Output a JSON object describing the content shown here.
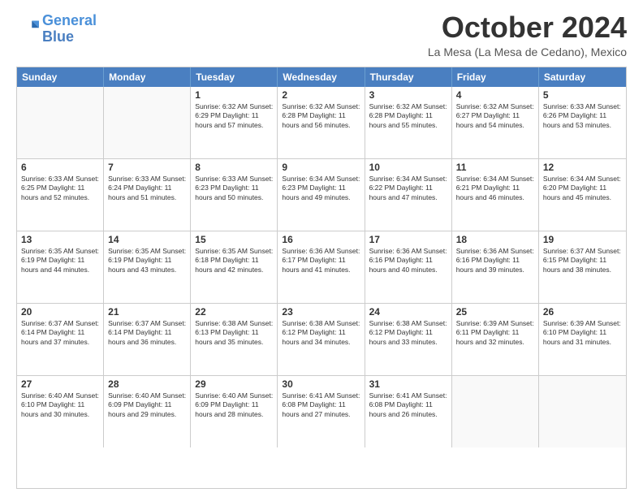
{
  "logo": {
    "line1": "General",
    "line2": "Blue"
  },
  "title": "October 2024",
  "location": "La Mesa (La Mesa de Cedano), Mexico",
  "header_days": [
    "Sunday",
    "Monday",
    "Tuesday",
    "Wednesday",
    "Thursday",
    "Friday",
    "Saturday"
  ],
  "weeks": [
    [
      {
        "day": "",
        "detail": ""
      },
      {
        "day": "",
        "detail": ""
      },
      {
        "day": "1",
        "detail": "Sunrise: 6:32 AM\nSunset: 6:29 PM\nDaylight: 11 hours and 57 minutes."
      },
      {
        "day": "2",
        "detail": "Sunrise: 6:32 AM\nSunset: 6:28 PM\nDaylight: 11 hours and 56 minutes."
      },
      {
        "day": "3",
        "detail": "Sunrise: 6:32 AM\nSunset: 6:28 PM\nDaylight: 11 hours and 55 minutes."
      },
      {
        "day": "4",
        "detail": "Sunrise: 6:32 AM\nSunset: 6:27 PM\nDaylight: 11 hours and 54 minutes."
      },
      {
        "day": "5",
        "detail": "Sunrise: 6:33 AM\nSunset: 6:26 PM\nDaylight: 11 hours and 53 minutes."
      }
    ],
    [
      {
        "day": "6",
        "detail": "Sunrise: 6:33 AM\nSunset: 6:25 PM\nDaylight: 11 hours and 52 minutes."
      },
      {
        "day": "7",
        "detail": "Sunrise: 6:33 AM\nSunset: 6:24 PM\nDaylight: 11 hours and 51 minutes."
      },
      {
        "day": "8",
        "detail": "Sunrise: 6:33 AM\nSunset: 6:23 PM\nDaylight: 11 hours and 50 minutes."
      },
      {
        "day": "9",
        "detail": "Sunrise: 6:34 AM\nSunset: 6:23 PM\nDaylight: 11 hours and 49 minutes."
      },
      {
        "day": "10",
        "detail": "Sunrise: 6:34 AM\nSunset: 6:22 PM\nDaylight: 11 hours and 47 minutes."
      },
      {
        "day": "11",
        "detail": "Sunrise: 6:34 AM\nSunset: 6:21 PM\nDaylight: 11 hours and 46 minutes."
      },
      {
        "day": "12",
        "detail": "Sunrise: 6:34 AM\nSunset: 6:20 PM\nDaylight: 11 hours and 45 minutes."
      }
    ],
    [
      {
        "day": "13",
        "detail": "Sunrise: 6:35 AM\nSunset: 6:19 PM\nDaylight: 11 hours and 44 minutes."
      },
      {
        "day": "14",
        "detail": "Sunrise: 6:35 AM\nSunset: 6:19 PM\nDaylight: 11 hours and 43 minutes."
      },
      {
        "day": "15",
        "detail": "Sunrise: 6:35 AM\nSunset: 6:18 PM\nDaylight: 11 hours and 42 minutes."
      },
      {
        "day": "16",
        "detail": "Sunrise: 6:36 AM\nSunset: 6:17 PM\nDaylight: 11 hours and 41 minutes."
      },
      {
        "day": "17",
        "detail": "Sunrise: 6:36 AM\nSunset: 6:16 PM\nDaylight: 11 hours and 40 minutes."
      },
      {
        "day": "18",
        "detail": "Sunrise: 6:36 AM\nSunset: 6:16 PM\nDaylight: 11 hours and 39 minutes."
      },
      {
        "day": "19",
        "detail": "Sunrise: 6:37 AM\nSunset: 6:15 PM\nDaylight: 11 hours and 38 minutes."
      }
    ],
    [
      {
        "day": "20",
        "detail": "Sunrise: 6:37 AM\nSunset: 6:14 PM\nDaylight: 11 hours and 37 minutes."
      },
      {
        "day": "21",
        "detail": "Sunrise: 6:37 AM\nSunset: 6:14 PM\nDaylight: 11 hours and 36 minutes."
      },
      {
        "day": "22",
        "detail": "Sunrise: 6:38 AM\nSunset: 6:13 PM\nDaylight: 11 hours and 35 minutes."
      },
      {
        "day": "23",
        "detail": "Sunrise: 6:38 AM\nSunset: 6:12 PM\nDaylight: 11 hours and 34 minutes."
      },
      {
        "day": "24",
        "detail": "Sunrise: 6:38 AM\nSunset: 6:12 PM\nDaylight: 11 hours and 33 minutes."
      },
      {
        "day": "25",
        "detail": "Sunrise: 6:39 AM\nSunset: 6:11 PM\nDaylight: 11 hours and 32 minutes."
      },
      {
        "day": "26",
        "detail": "Sunrise: 6:39 AM\nSunset: 6:10 PM\nDaylight: 11 hours and 31 minutes."
      }
    ],
    [
      {
        "day": "27",
        "detail": "Sunrise: 6:40 AM\nSunset: 6:10 PM\nDaylight: 11 hours and 30 minutes."
      },
      {
        "day": "28",
        "detail": "Sunrise: 6:40 AM\nSunset: 6:09 PM\nDaylight: 11 hours and 29 minutes."
      },
      {
        "day": "29",
        "detail": "Sunrise: 6:40 AM\nSunset: 6:09 PM\nDaylight: 11 hours and 28 minutes."
      },
      {
        "day": "30",
        "detail": "Sunrise: 6:41 AM\nSunset: 6:08 PM\nDaylight: 11 hours and 27 minutes."
      },
      {
        "day": "31",
        "detail": "Sunrise: 6:41 AM\nSunset: 6:08 PM\nDaylight: 11 hours and 26 minutes."
      },
      {
        "day": "",
        "detail": ""
      },
      {
        "day": "",
        "detail": ""
      }
    ]
  ]
}
